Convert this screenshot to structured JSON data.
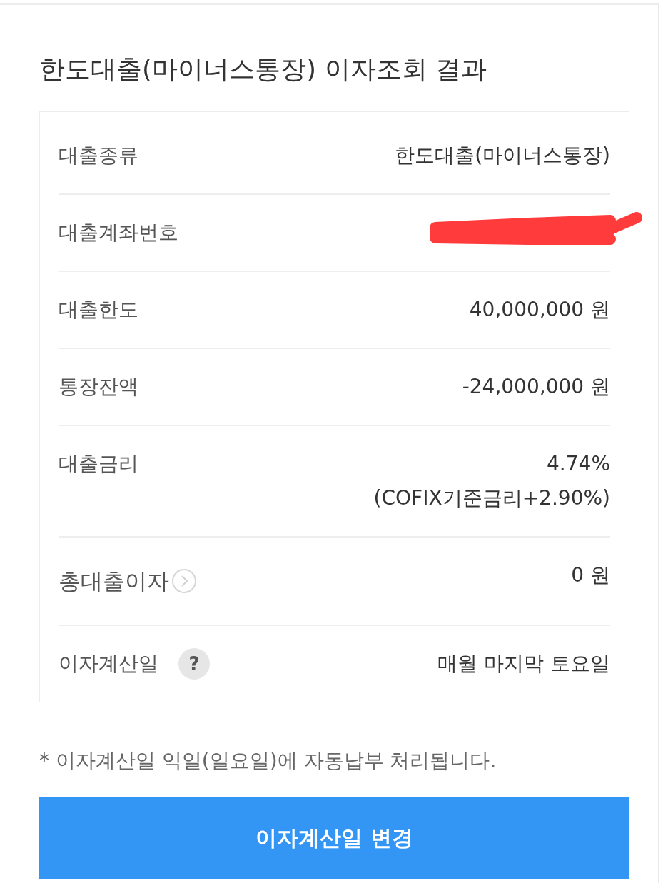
{
  "title": "한도대출(마이너스통장) 이자조회 결과",
  "rows": [
    {
      "kind": "plain",
      "label": "대출종류",
      "values": [
        "한도대출(마이너스통장)"
      ]
    },
    {
      "kind": "plain",
      "label": "대출계좌번호",
      "redacted": true
    },
    {
      "kind": "plain",
      "label": "대출한도",
      "values": [
        "40,000,000 원"
      ]
    },
    {
      "kind": "plain",
      "label": "통장잔액",
      "values": [
        "-24,000,000 원"
      ]
    },
    {
      "kind": "plain",
      "label": "대출금리",
      "values": [
        "4.74%",
        "(COFIX기준금리+2.90%)"
      ]
    },
    {
      "kind": "link",
      "label": "총대출이자",
      "values": [
        "0 원"
      ]
    },
    {
      "kind": "help",
      "label": "이자계산일",
      "icon": "?",
      "values": [
        "매월 마지막 토요일"
      ]
    }
  ],
  "note": "* 이자계산일 익일(일요일)에 자동납부 처리됩니다.",
  "button": {
    "label": "이자계산일 변경"
  }
}
